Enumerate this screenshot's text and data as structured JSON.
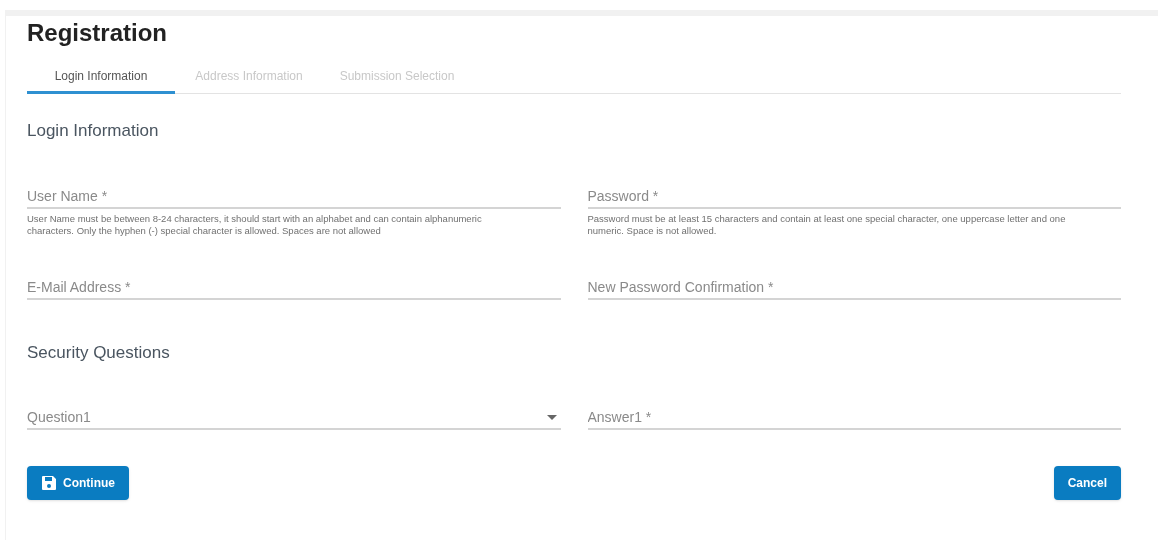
{
  "title": "Registration",
  "tabs": [
    {
      "label": "Login Information",
      "selected": true
    },
    {
      "label": "Address Information",
      "selected": false
    },
    {
      "label": "Submission Selection",
      "selected": false
    }
  ],
  "sections": [
    {
      "heading": "Login Information",
      "fields": [
        {
          "kind": "text",
          "placeholder": "User Name *",
          "hint": "User Name must be between 8-24 characters, it should start with an alphabet and can contain alphanumeric characters. Only the hyphen (-) special character is allowed. Spaces are not allowed"
        },
        {
          "kind": "text",
          "placeholder": "Password *",
          "hint": "Password must be at least 15 characters and contain at least one special character, one uppercase letter and one numeric. Space is not allowed."
        },
        {
          "kind": "text",
          "placeholder": "E-Mail Address *"
        },
        {
          "kind": "text",
          "placeholder": "New Password Confirmation *"
        }
      ]
    },
    {
      "heading": "Security Questions",
      "fields": [
        {
          "kind": "select",
          "placeholder": "Question1"
        },
        {
          "kind": "text",
          "placeholder": "Answer1 *"
        }
      ]
    }
  ],
  "buttons": [
    {
      "label": "Continue",
      "kind": "save"
    },
    {
      "label": "Cancel",
      "kind": "plain"
    }
  ]
}
